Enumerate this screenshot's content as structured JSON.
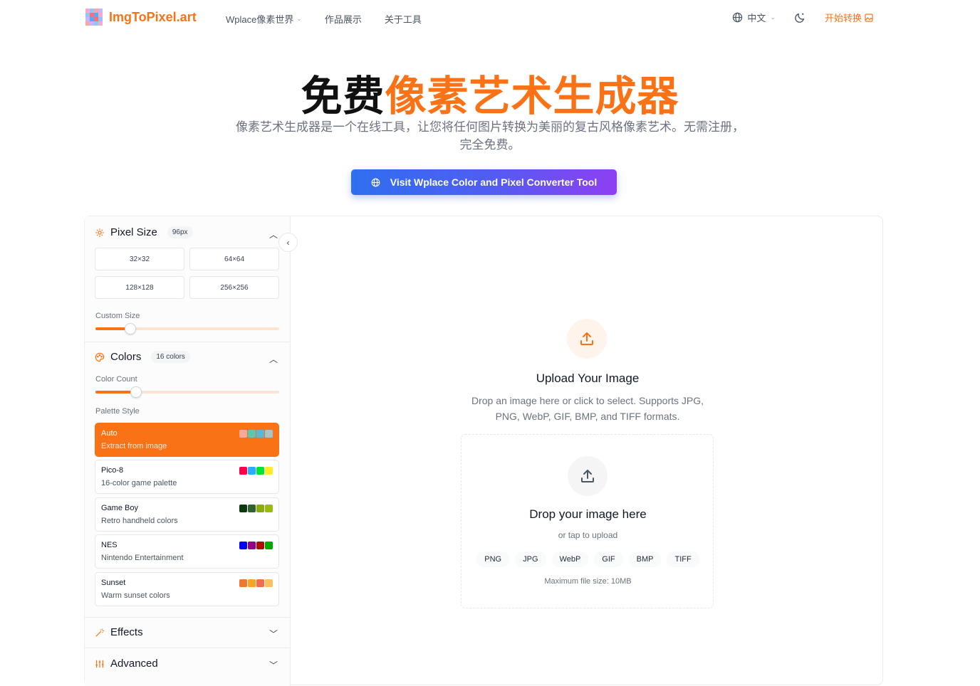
{
  "nav": {
    "logo_text": "ImgToPixel.art",
    "links": [
      {
        "label": "Wplace像素世界",
        "dropdown": true
      },
      {
        "label": "作品展示",
        "dropdown": false
      },
      {
        "label": "关于工具",
        "dropdown": false
      }
    ],
    "language": "中文",
    "start_label": "开始转换"
  },
  "hero": {
    "title_black": "免费",
    "title_orange": "像素艺术生成器",
    "subtitle": "像素艺术生成器是一个在线工具，让您将任何图片转换为美丽的复古风格像素艺术。无需注册，完全免费。",
    "cta_label": "Visit Wplace Color and Pixel Converter Tool"
  },
  "sidebar": {
    "pixel_size": {
      "title": "Pixel Size",
      "badge": "96px",
      "options": [
        "32×32",
        "64×64",
        "128×128",
        "256×256"
      ],
      "custom_label": "Custom Size",
      "slider_fraction": 0.19
    },
    "colors": {
      "title": "Colors",
      "badge": "16 colors",
      "count_label": "Color Count",
      "slider_fraction": 0.22,
      "palette_label": "Palette Style",
      "palettes": [
        {
          "name": "Auto",
          "desc": "Extract from image",
          "active": true,
          "swatches": [
            "#f7a99a",
            "#5cc7b0",
            "#57b8d9",
            "#a7c4c6"
          ]
        },
        {
          "name": "Pico-8",
          "desc": "16-color game palette",
          "active": false,
          "swatches": [
            "#ff004d",
            "#29adff",
            "#00e436",
            "#ffec27"
          ]
        },
        {
          "name": "Game Boy",
          "desc": "Retro handheld colors",
          "active": false,
          "swatches": [
            "#0f380f",
            "#306230",
            "#8bac0f",
            "#9bbc0f"
          ]
        },
        {
          "name": "NES",
          "desc": "Nintendo Entertainment",
          "active": false,
          "swatches": [
            "#0000fc",
            "#940084",
            "#a81000",
            "#00a800"
          ]
        },
        {
          "name": "Sunset",
          "desc": "Warm sunset colors",
          "active": false,
          "swatches": [
            "#f0772f",
            "#f5a623",
            "#f26c4f",
            "#fbc15e"
          ]
        }
      ]
    },
    "effects": {
      "title": "Effects"
    },
    "advanced": {
      "title": "Advanced"
    }
  },
  "upload": {
    "title": "Upload Your Image",
    "desc": "Drop an image here or click to select. Supports JPG, PNG, WebP, GIF, BMP, and TIFF formats.",
    "drop_title": "Drop your image here",
    "drop_sub": "or tap to upload",
    "formats": [
      "PNG",
      "JPG",
      "WebP",
      "GIF",
      "BMP",
      "TIFF"
    ],
    "max_size": "Maximum file size: 10MB"
  },
  "colors": {
    "accent": "#f97316",
    "cta_start": "#2f6ff0",
    "cta_end": "#8e3ff1"
  }
}
